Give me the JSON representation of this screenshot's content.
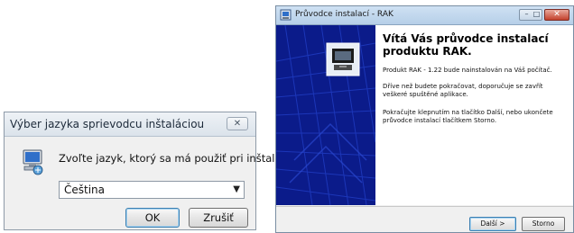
{
  "language_dialog": {
    "title": "Výber jazyka sprievodcu inštaláciou",
    "close_label": "✕",
    "prompt": "Zvoľte jazyk, ktorý sa má použiť pri inštalácii:",
    "language_select": {
      "selected": "Čeština"
    },
    "ok_label": "OK",
    "cancel_label": "Zrušiť"
  },
  "wizard": {
    "title": "Průvodce instalací - RAK",
    "minimize_label": "–",
    "maximize_label": "□",
    "close_label": "✕",
    "heading": "Vítá Vás průvodce instalací produktu RAK.",
    "paragraphs": [
      "Produkt RAK - 1.22 bude nainstalován na Váš počítač.",
      "Dříve než budete pokračovat, doporučuje se zavřít veškeré spuštěné aplikace.",
      "Pokračujte klepnutím na tlačítko Další, nebo ukončete průvodce instalací tlačítkem Storno."
    ],
    "next_label": "Další >",
    "cancel_label": "Storno"
  },
  "colors": {
    "wizard_sidebar": "#0b1b8a",
    "default_button_border": "#3c7fb1",
    "close_button": "#c4412c"
  },
  "icons": [
    "setup-computer-icon",
    "installer-app-icon",
    "installer-logo-icon",
    "dropdown-arrow-icon"
  ]
}
